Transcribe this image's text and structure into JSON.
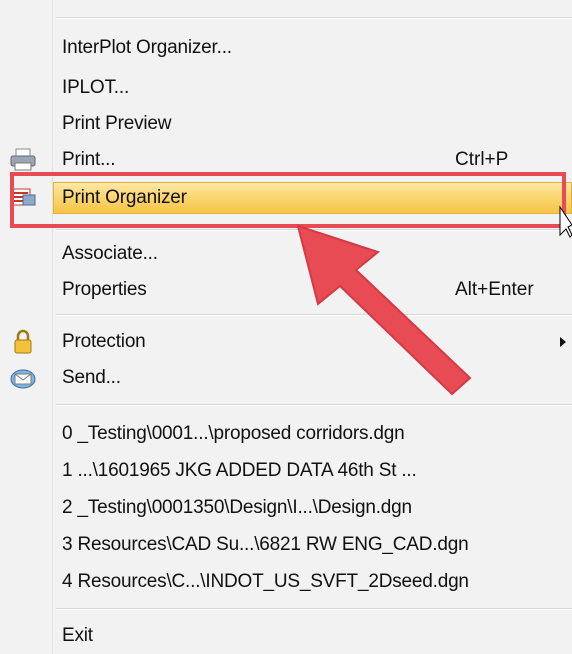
{
  "menu": {
    "items_top": [
      {
        "label": "InterPlot Organizer..."
      },
      {
        "label": "IPLOT..."
      },
      {
        "label": "Print Preview"
      },
      {
        "label": "Print...",
        "shortcut": "Ctrl+P",
        "icon": "printer-icon"
      },
      {
        "label": "Print Organizer",
        "icon": "print-organizer-icon",
        "highlighted": true
      }
    ],
    "items_mid": [
      {
        "label": "Associate..."
      },
      {
        "label": "Properties",
        "shortcut": "Alt+Enter"
      }
    ],
    "items_send": [
      {
        "label": "Protection",
        "icon": "lock-icon",
        "submenu": true
      },
      {
        "label": "Send...",
        "icon": "mail-icon"
      }
    ],
    "recent_files": [
      "0 _Testing\\0001...\\proposed corridors.dgn",
      "1 ...\\1601965  JKG ADDED DATA 46th St ...",
      "2 _Testing\\0001350\\Design\\I...\\Design.dgn",
      "3 Resources\\CAD Su...\\6821 RW ENG_CAD.dgn",
      "4 Resources\\C...\\INDOT_US_SVFT_2Dseed.dgn"
    ],
    "exit": "Exit"
  },
  "annotation": {
    "box_color": "#e94b55",
    "arrow_color": "#e94b55"
  },
  "colors": {
    "highlight_top": "#fde8a6",
    "highlight_bottom": "#f6c446"
  }
}
